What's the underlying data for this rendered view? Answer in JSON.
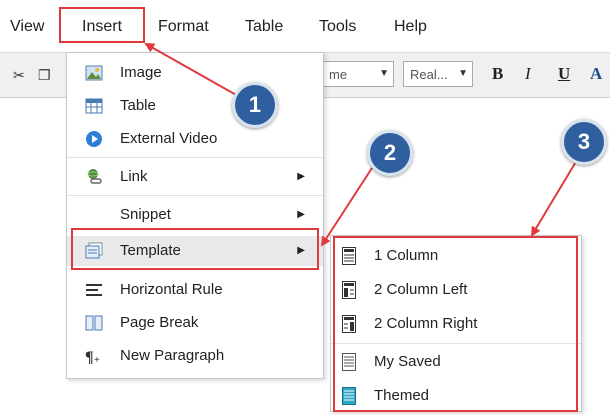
{
  "menubar": {
    "items": [
      {
        "label": "View"
      },
      {
        "label": "Insert"
      },
      {
        "label": "Format"
      },
      {
        "label": "Table"
      },
      {
        "label": "Tools"
      },
      {
        "label": "Help"
      }
    ]
  },
  "toolbar": {
    "font_combo_value": "me",
    "size_combo_value": "Real...",
    "bold_label": "B",
    "italic_label": "I",
    "underline_label": "U",
    "color_label": "A"
  },
  "insert_menu": {
    "items": [
      {
        "label": "Image",
        "icon": "image-icon"
      },
      {
        "label": "Table",
        "icon": "table-icon"
      },
      {
        "label": "External Video",
        "icon": "video-icon"
      },
      {
        "label": "Link",
        "icon": "link-icon"
      },
      {
        "label": "Snippet",
        "icon": ""
      },
      {
        "label": "Template",
        "icon": "template-icon"
      },
      {
        "label": "Horizontal Rule",
        "icon": "horizontal-rule-icon"
      },
      {
        "label": "Page Break",
        "icon": "page-break-icon"
      },
      {
        "label": "New Paragraph",
        "icon": "paragraph-icon"
      }
    ]
  },
  "template_submenu": {
    "items": [
      {
        "label": "1 Column"
      },
      {
        "label": "2 Column Left"
      },
      {
        "label": "2 Column Right"
      },
      {
        "label": "My Saved"
      },
      {
        "label": "Themed"
      }
    ]
  },
  "callouts": [
    "1",
    "2",
    "3"
  ],
  "colors": {
    "highlight": "#e0393e",
    "badge": "#2f5f9e"
  }
}
